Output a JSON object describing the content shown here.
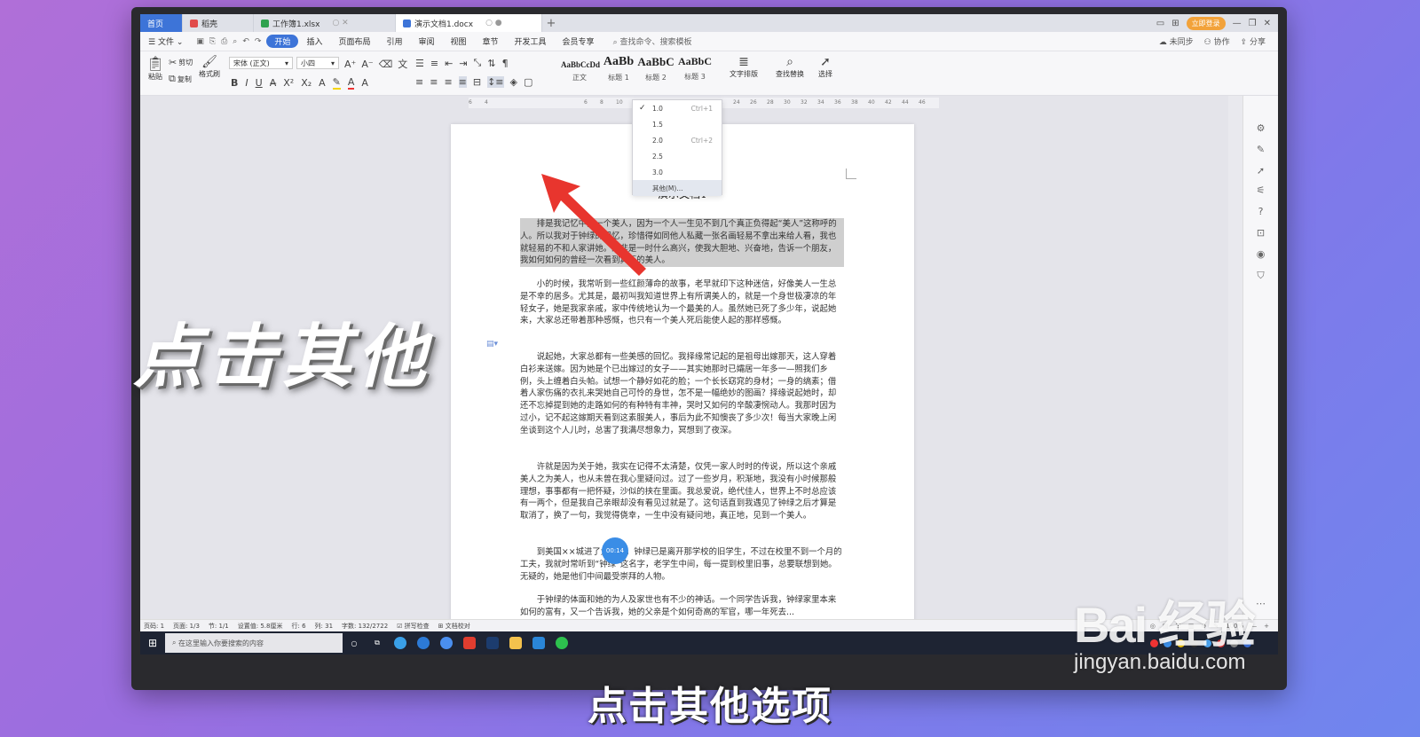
{
  "tabs": [
    {
      "label": "首页",
      "icon": "home"
    },
    {
      "label": "稻壳",
      "icon": "docer-icon",
      "color": "#e14b4b"
    },
    {
      "label": "工作簿1.xlsx",
      "icon": "spreadsheet-icon",
      "color": "#2fa24f"
    },
    {
      "label": "演示文档1.docx",
      "icon": "word-doc-icon",
      "color": "#3d74d8"
    }
  ],
  "login_label": "立即登录",
  "menu": {
    "file": "文件",
    "items": [
      "开始",
      "插入",
      "页面布局",
      "引用",
      "审阅",
      "视图",
      "章节",
      "开发工具",
      "会员专享"
    ],
    "active": "开始",
    "search": "查找命令、搜索模板",
    "right": [
      "未同步",
      "协作",
      "分享"
    ]
  },
  "ribbon": {
    "paste": "粘贴",
    "cut": "剪切",
    "copy": "复制",
    "format_painter": "格式刷",
    "font_name": "宋体 (正文)",
    "font_size": "小四",
    "styles": [
      {
        "preview": "AaBbCcDd",
        "label": "正文"
      },
      {
        "preview": "AaBb",
        "label": "标题 1"
      },
      {
        "preview": "AaBbC",
        "label": "标题 2"
      },
      {
        "preview": "AaBbC",
        "label": "标题 3"
      }
    ],
    "text_layout": "文字排版",
    "find_replace": "查找替换",
    "select": "选择"
  },
  "ruler_ticks": [
    "6",
    "4",
    "2",
    "2",
    "4",
    "6",
    "8",
    "10",
    "12",
    "14",
    "16",
    "18",
    "20",
    "22",
    "24",
    "26",
    "28",
    "30",
    "32",
    "34",
    "36",
    "38",
    "40",
    "42",
    "44",
    "46"
  ],
  "line_spacing_menu": [
    {
      "value": "1.0",
      "shortcut": "Ctrl+1",
      "checked": true
    },
    {
      "value": "1.5",
      "shortcut": "",
      "checked": false
    },
    {
      "value": "2.0",
      "shortcut": "Ctrl+2",
      "checked": false
    },
    {
      "value": "2.5",
      "shortcut": "",
      "checked": false
    },
    {
      "value": "3.0",
      "shortcut": "",
      "checked": false
    },
    {
      "value": "其他(M)...",
      "shortcut": "",
      "checked": false
    }
  ],
  "document": {
    "title": "演示文档1",
    "paragraphs": [
      "排是我记忆中第一个美人，因为一个人一生见不到几个真正负得起“美人”这称呼的人。所以我对于钟绿的记忆，珍惜得如同他人私藏一张名画轻易不拿出来给人看，我也就轻易的不和人家讲她。除非是一时什么高兴，使我大胆地、兴奋地，告诉一个朋友，我如何如何的曾经一次看到真正的美人。",
      "小的时候，我常听到一些红颜薄命的故事，老早就印下这种迷信，好像美人一生总是不幸的居多。尤其是，最初叫我知道世界上有所谓美人的，就是一个身世极凄凉的年轻女子，她是我家亲戚，家中传统地认为一个最美的人。虽然她已死了多少年，说起她来，大家总还带着那种感慨，也只有一个美人死后能使人起的那样感慨。",
      "说起她，大家总都有一些美感的回忆。我择缘常记起的是祖母出嫁那天，这人穿着白衫来送嫁。因为她是个已出嫁过的女子——其实她那时已孀居一年多一—照我们乡例，头上缠着白头帕。试想一个静好如花的脸；一个长长窈窕的身材；一身的缟素；借着人家伤痛的衣扎来哭她自己可怜的身世，怎不是一幅绝妙的图画？择缘说起她时，却还不忘掉提到她的走路如何的有种特有丰神，哭时又如何的辛酸凄惋动人。我那时因为过小，记不起这嫁期天看到这素服美人，事后为此不知懊丧了多少次！每当大家晚上闲坐谈到这个人儿时，总害了我满尽想象力，冥想到了夜深。",
      "许就是因为关于她，我实在记得不太清楚，仅凭一家人时时的传说，所以这个亲戚美人之为美人，也从未曾在我心里疑问过。过了一些岁月，积渐地，我没有小时候那般理想，事事都有一把怀疑，沙似的挟在里面。我总爱说，绝代佳人，世界上不时总应该有一两个，但是我自己亲眼却没有看见过就是了。这句话直到我遇见了钟绿之后才算是取消了，换了一句，我觉得侥幸，一生中没有疑问地，真正地，见到一个美人。",
      "到美国××城进了大学时，钟绿已是离开那学校的旧学生，不过在校里不到一个月的工夫，我就时常听到“钟绿”这名字，老学生中间，每一提到校里旧事，总要联想到她。无疑的，她是他们中间最受崇拜的人物。",
      "于钟绿的体面和她的为人及家世也有不少的神话。一个同学告诉我，钟绿家里本来如何的富有，又一个告诉我，她的父亲是个如何奇高的军官，哪一年死去..."
    ]
  },
  "timer": "00:14",
  "status_bar": {
    "items": [
      "页码: 1",
      "页面: 1/3",
      "节: 1/1",
      "设置值: 5.8厘米",
      "行: 6",
      "列: 31",
      "字数: 132/2722",
      "拼写检查",
      "文档校对"
    ],
    "zoom": "100%"
  },
  "taskbar": {
    "search_placeholder": "在这里输入你要搜索的内容"
  },
  "overlay": {
    "big_caption": "点击其他",
    "subtitle": "点击其他选项"
  },
  "watermark": {
    "logo": "Bai 经验",
    "url": "jingyan.baidu.com"
  },
  "colors": {
    "accent": "#3d74d8",
    "arrow": "#e8352e",
    "timer": "#3a8de6"
  }
}
